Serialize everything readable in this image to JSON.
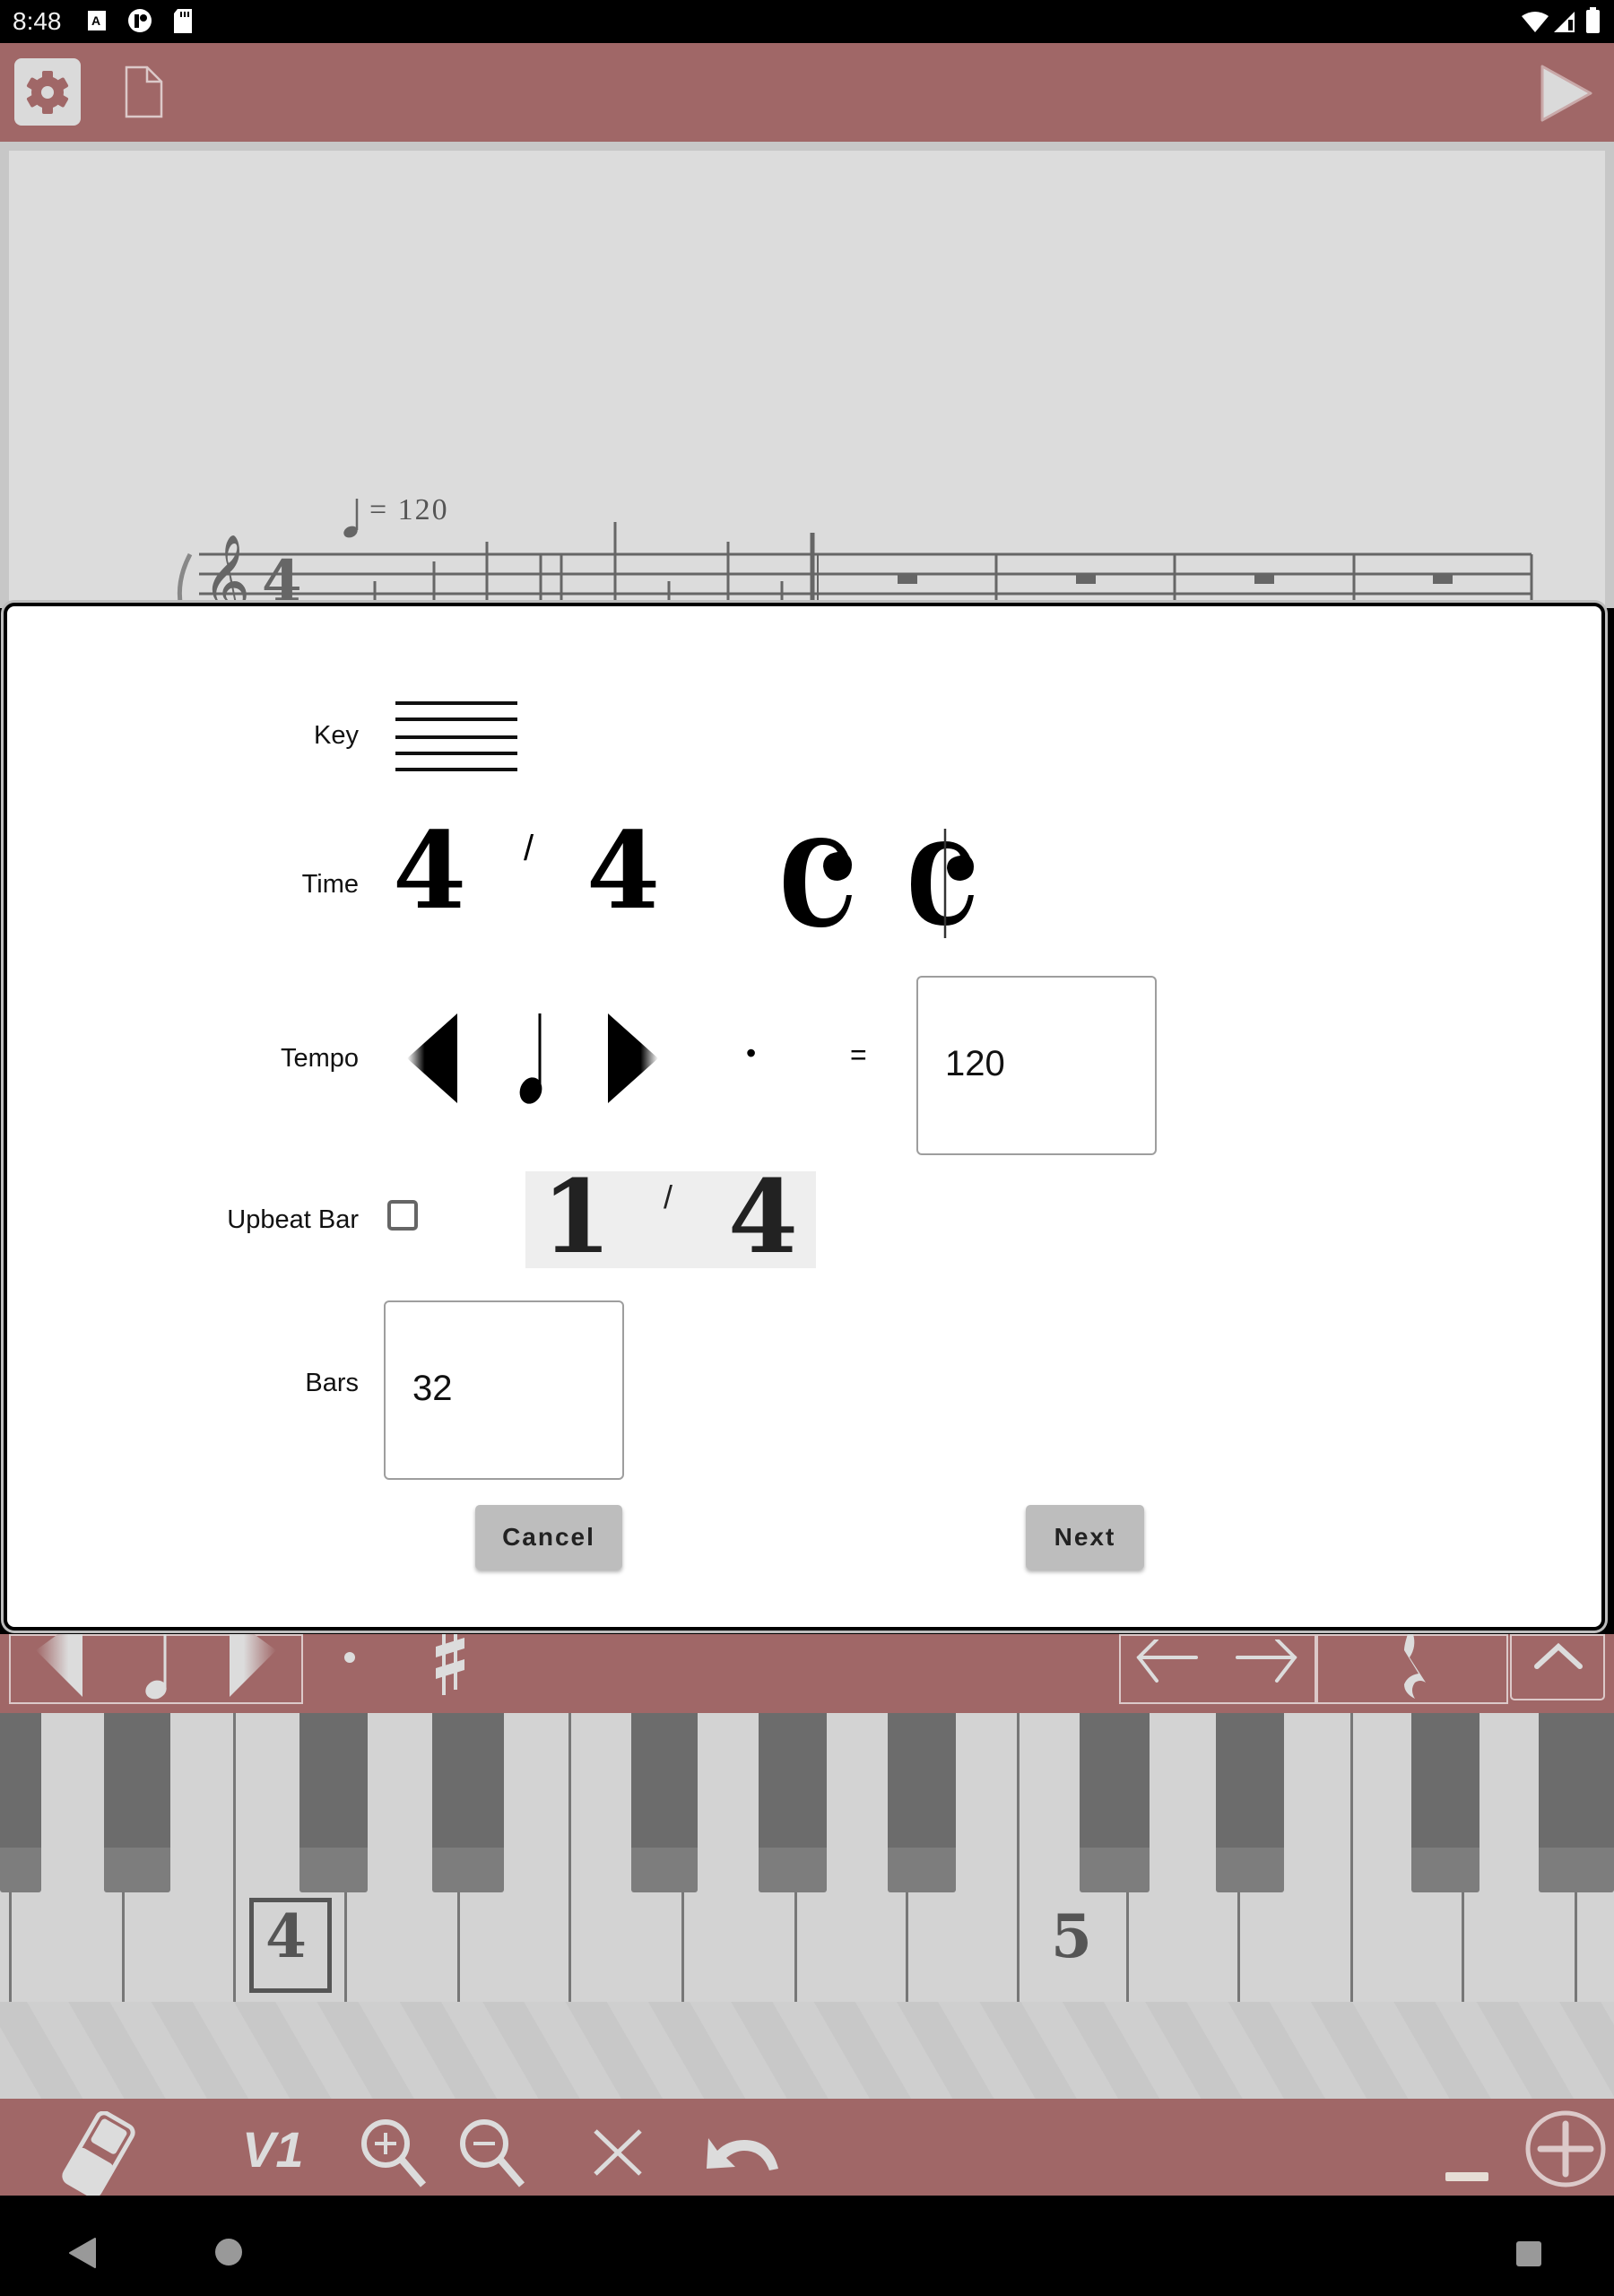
{
  "status_bar": {
    "time": "8:48",
    "left_icons": [
      "keyboard-a-icon",
      "app-notification-icon",
      "sd-card-icon"
    ],
    "right_icons": [
      "wifi-icon",
      "cell-signal-icon",
      "battery-icon"
    ]
  },
  "top_toolbar": {
    "buttons": [
      "settings-icon",
      "new-document-icon",
      "play-icon"
    ]
  },
  "score": {
    "tempo_marking": "= 120",
    "clef": "treble",
    "time_signature_visible": "4",
    "rest_bars_visible": 4
  },
  "dialog": {
    "key": {
      "label": "Key",
      "value": "no accidentals (C major)"
    },
    "time": {
      "label": "Time",
      "numerator": "4",
      "separator": "/",
      "denominator": "4",
      "common_time_symbol": "C",
      "cut_time_symbol": "¢"
    },
    "tempo": {
      "label": "Tempo",
      "note_value": "quarter",
      "dot": "•",
      "equals": "=",
      "value": "120"
    },
    "upbeat_bar": {
      "label": "Upbeat Bar",
      "checked": false,
      "numerator": "1",
      "separator": "/",
      "denominator": "4"
    },
    "bars": {
      "label": "Bars",
      "value": "32"
    },
    "cancel_label": "Cancel",
    "next_label": "Next"
  },
  "note_toolbar": {
    "items": [
      "prev-note-value-icon",
      "quarter-note-icon",
      "next-note-value-icon",
      "dot-icon",
      "sharp-icon",
      "cursor-left-icon",
      "cursor-right-icon",
      "quarter-rest-icon",
      "chevron-up-icon"
    ]
  },
  "keyboard": {
    "octave_labels": [
      "4",
      "5"
    ],
    "highlighted_octave": "4"
  },
  "bottom_toolbar": {
    "voice_label": "V1",
    "items": [
      "eraser-icon",
      "voice-selector",
      "zoom-in-icon",
      "zoom-out-icon",
      "delete-icon",
      "undo-icon",
      "minus-icon",
      "add-circle-icon"
    ]
  },
  "nav_bar": {
    "items": [
      "back-icon",
      "home-icon",
      "recents-icon"
    ]
  },
  "colors": {
    "toolbar": "#a06767",
    "score_background": "#dcdcdc",
    "dialog_background": "#ffffff",
    "button": "#bdbdbd",
    "icon_light": "#dcdcdc"
  }
}
